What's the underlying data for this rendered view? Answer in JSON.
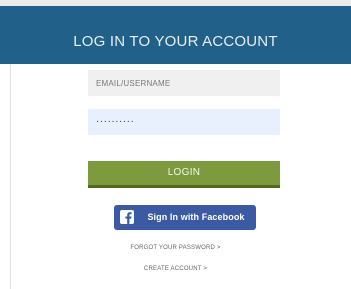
{
  "header": {
    "title": "LOG IN TO YOUR ACCOUNT"
  },
  "form": {
    "email_placeholder": "EMAIL/USERNAME",
    "password_value": "··········",
    "login_label": "LOGIN",
    "facebook_label": "Sign In with Facebook",
    "facebook_icon": "facebook-f-icon",
    "forgot_password_label": "FORGOT YOUR PASSWORD >",
    "create_account_label": "CREATE ACCOUNT >"
  },
  "colors": {
    "header_bg": "#216088",
    "login_button": "#7d9b3e",
    "facebook_button": "#3b5aa3",
    "password_field_bg": "#e8f0fd"
  }
}
